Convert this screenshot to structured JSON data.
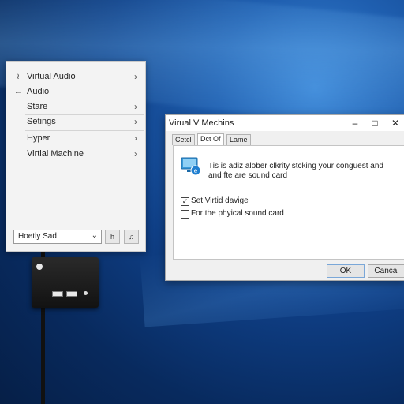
{
  "menu": {
    "items": [
      {
        "label": "Virtual Audio",
        "icon": "audio-wave-icon",
        "chevron": true
      },
      {
        "label": "Audio",
        "icon": "back-arrow-icon",
        "chevron": false
      },
      {
        "label": "Stare",
        "icon": "",
        "chevron": true
      },
      {
        "label": "Setings",
        "icon": "",
        "chevron": true
      },
      {
        "label": "Hyper",
        "icon": "",
        "chevron": true
      },
      {
        "label": "Virtial Machine",
        "icon": "",
        "chevron": true
      }
    ],
    "dropdown": {
      "value": "Hoetly Sad"
    },
    "buttons": [
      "h",
      "♫"
    ]
  },
  "dialog": {
    "title": "Virual V Mechins",
    "tabs": [
      "Cetcl",
      "Dct Of",
      "Lame"
    ],
    "active_tab": 1,
    "info_line1": "Tis is adiz alober clkrity stcking your conguest and",
    "info_line2": "and fte are sound card",
    "checkboxes": [
      {
        "label": "Set Virtid davige",
        "checked": true
      },
      {
        "label": "For the phyical sound card",
        "checked": false
      }
    ],
    "ok_label": "OK",
    "cancel_label": "Cancal"
  },
  "colors": {
    "desktop": "#0f3f86",
    "accent": "#3b86d6",
    "dialog_bg": "#f0f0f0"
  }
}
